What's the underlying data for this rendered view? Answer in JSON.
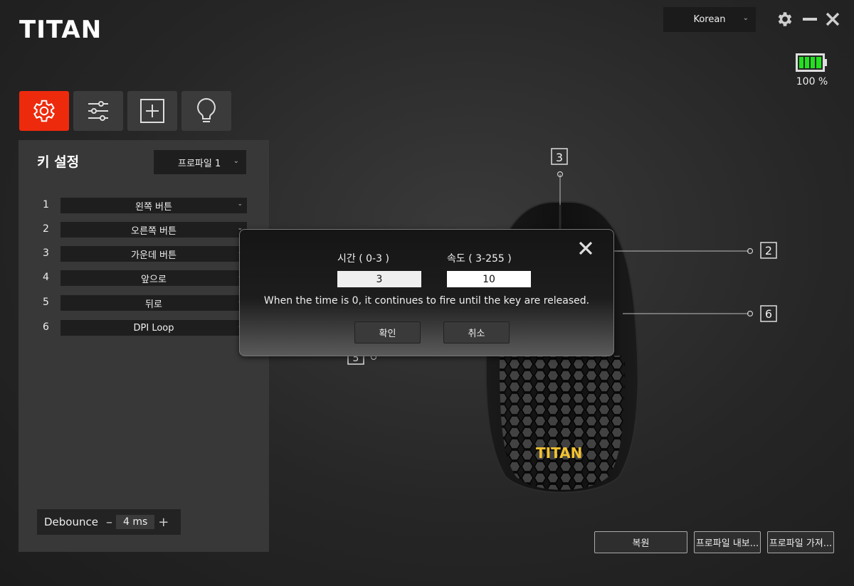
{
  "app": {
    "logo": "TITAN"
  },
  "header": {
    "language": "Korean",
    "battery_text": "100 %",
    "battery_level": 1.0
  },
  "tabs": [
    {
      "icon": "gear-icon"
    },
    {
      "icon": "sliders-icon"
    },
    {
      "icon": "macro-add-icon"
    },
    {
      "icon": "lightbulb-icon"
    }
  ],
  "key_settings": {
    "title": "키 설정",
    "profile": "프로파일 1",
    "rows": [
      {
        "num": "1",
        "value": "왼쪽 버튼"
      },
      {
        "num": "2",
        "value": "오른쪽 버튼"
      },
      {
        "num": "3",
        "value": "가운데 버튼"
      },
      {
        "num": "4",
        "value": "앞으로"
      },
      {
        "num": "5",
        "value": "뒤로"
      },
      {
        "num": "6",
        "value": "DPI Loop"
      }
    ],
    "debounce_label": "Debounce",
    "debounce_value": "4 ms"
  },
  "mouse_labels": {
    "top": "3",
    "right_upper": "2",
    "right_lower": "6",
    "left_hidden": "5"
  },
  "mouse_logo_text": "TITAN",
  "bottom_buttons": {
    "restore": "복원",
    "export": "프로파일 내보...",
    "import": "프로파일 가져..."
  },
  "modal": {
    "time_label": "시간 ( 0-3 )",
    "time_value": "3",
    "speed_label": "속도 ( 3-255 )",
    "speed_value": "10",
    "message": "When the time is 0, it continues to fire until the key are released.",
    "confirm": "확인",
    "cancel": "취소"
  },
  "colors": {
    "accent": "#ee2a0d",
    "battery": "#22e01e"
  }
}
